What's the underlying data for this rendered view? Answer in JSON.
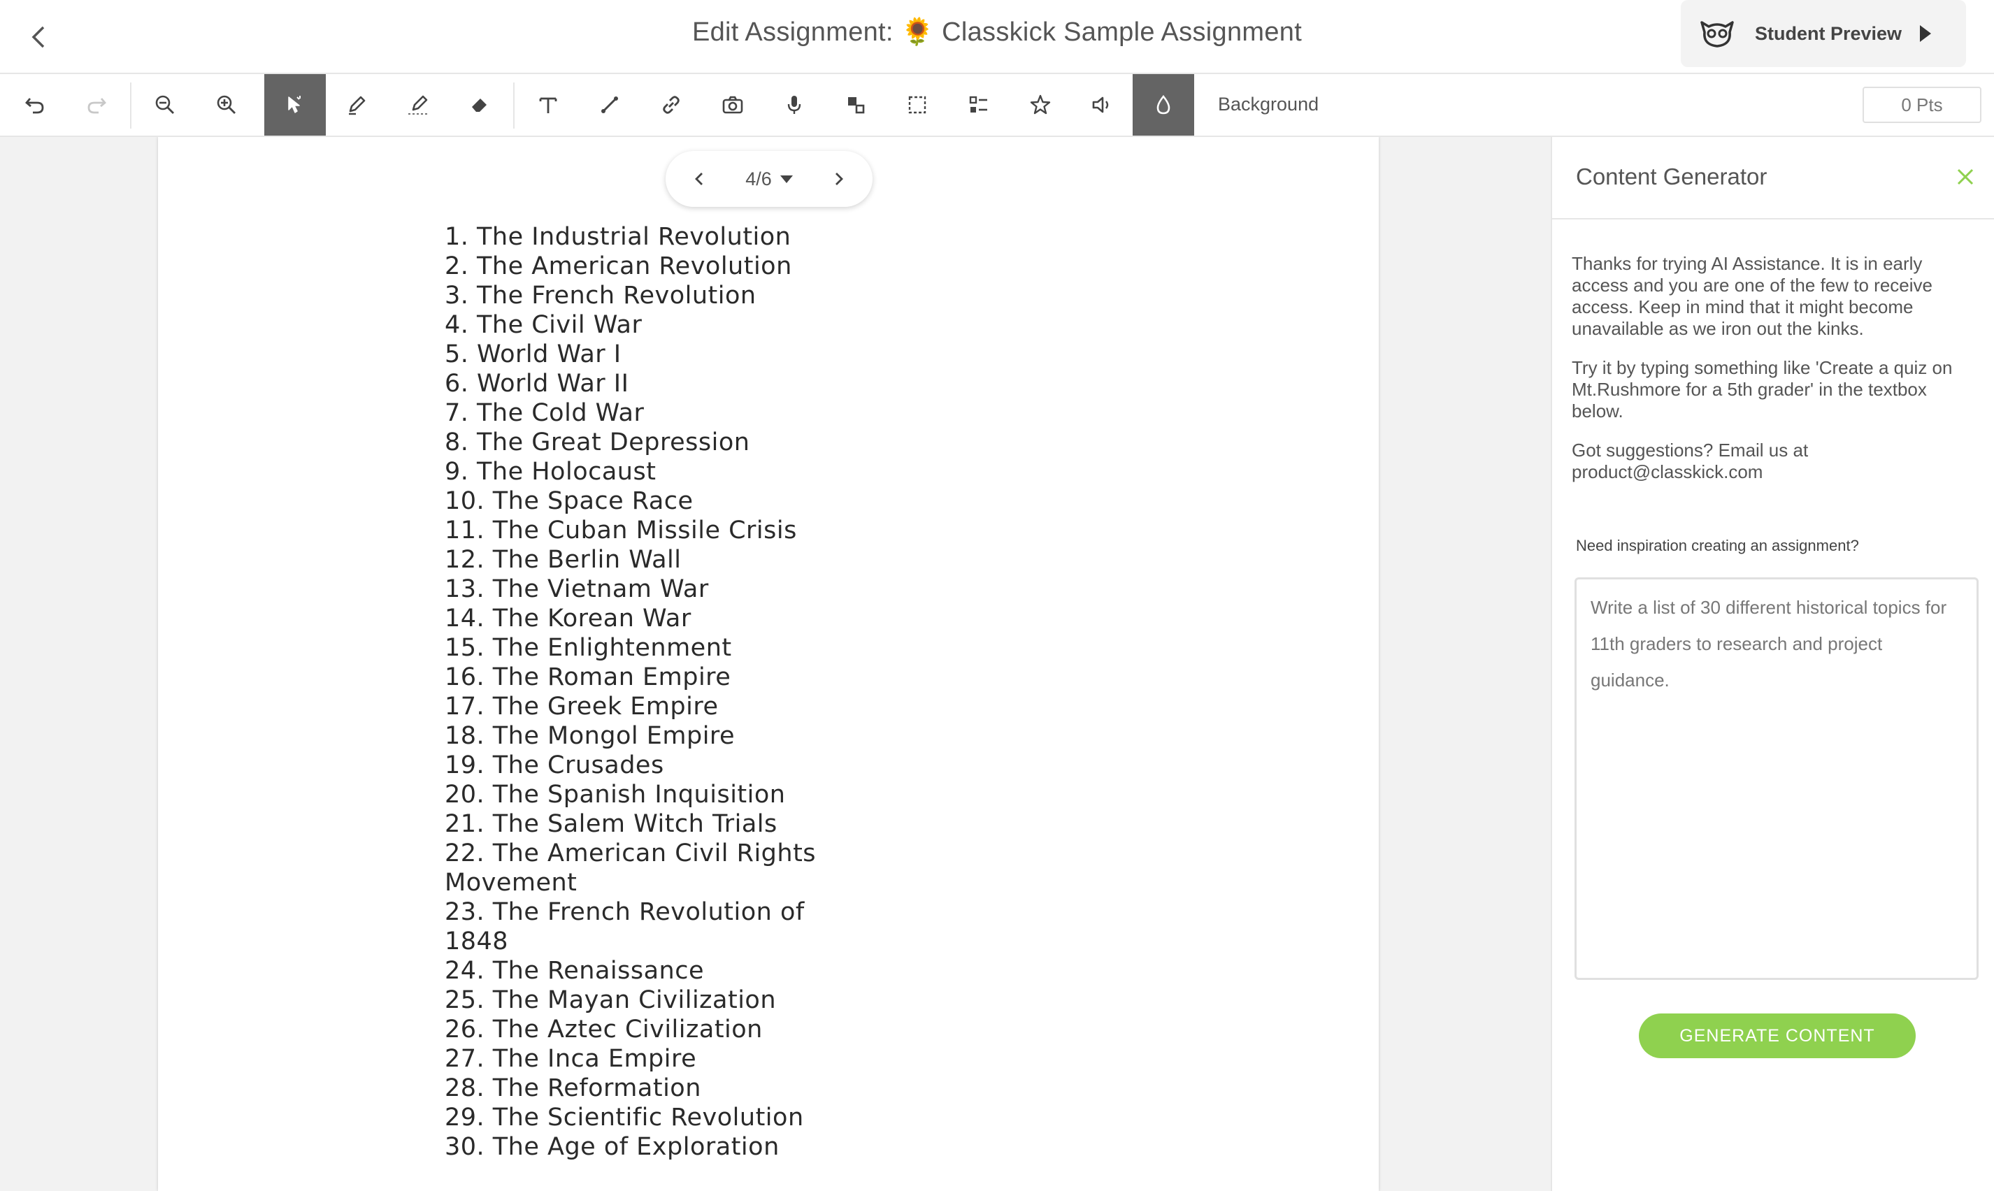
{
  "header": {
    "title": "Edit Assignment: 🌻 Classkick Sample Assignment",
    "student_preview_label": "Student Preview"
  },
  "toolbar": {
    "tools": [
      "undo-icon",
      "redo-icon",
      "zoom-out-icon",
      "zoom-in-icon",
      "pointer-icon",
      "pen-icon",
      "highlighter-icon",
      "eraser-icon",
      "text-icon",
      "line-icon",
      "link-icon",
      "camera-icon",
      "microphone-icon",
      "shapes-icon",
      "selection-icon",
      "checklist-icon",
      "star-icon",
      "speaker-icon",
      "fill-icon"
    ],
    "active_tools": [
      "pointer-icon",
      "fill-icon"
    ],
    "background_label": "Background",
    "points": "0 Pts"
  },
  "pager": {
    "current": "4/6"
  },
  "topics": [
    "1. The Industrial Revolution",
    "2. The American Revolution",
    "3. The French Revolution",
    "4. The Civil War",
    "5. World War I",
    "6. World War II",
    "7. The Cold War",
    "8. The Great Depression",
    "9. The Holocaust",
    "10. The Space Race",
    "11. The Cuban Missile Crisis",
    "12. The Berlin Wall",
    "13. The Vietnam War",
    "14. The Korean War",
    "15. The Enlightenment",
    "16. The Roman Empire",
    "17. The Greek Empire",
    "18. The Mongol Empire",
    "19. The Crusades",
    "20. The Spanish Inquisition",
    "21. The Salem Witch Trials",
    "22. The American Civil Rights Movement",
    "23. The French Revolution of 1848",
    "24. The Renaissance",
    "25. The Mayan Civilization",
    "26. The Aztec Civilization",
    "27. The Inca Empire",
    "28. The Reformation",
    "29. The Scientific Revolution",
    "30. The Age of Exploration"
  ],
  "panel": {
    "title": "Content Generator",
    "intro": "Thanks for trying AI Assistance. It is in early access and you are one of the few to receive access. Keep in mind that it might become unavailable as we iron out the kinks.",
    "try_text": "Try it by typing something like 'Create a quiz on Mt.Rushmore for a 5th grader' in the textbox below.",
    "suggest_text": "Got suggestions? Email us at product@classkick.com",
    "inspiration_label": "Need inspiration creating an assignment?",
    "prompt_value": "Write a list of 30 different historical topics for 11th graders to research and project guidance.",
    "generate_label": "GENERATE CONTENT"
  },
  "colors": {
    "accent_green": "#8fd14f",
    "active_tool_bg": "#646464"
  }
}
